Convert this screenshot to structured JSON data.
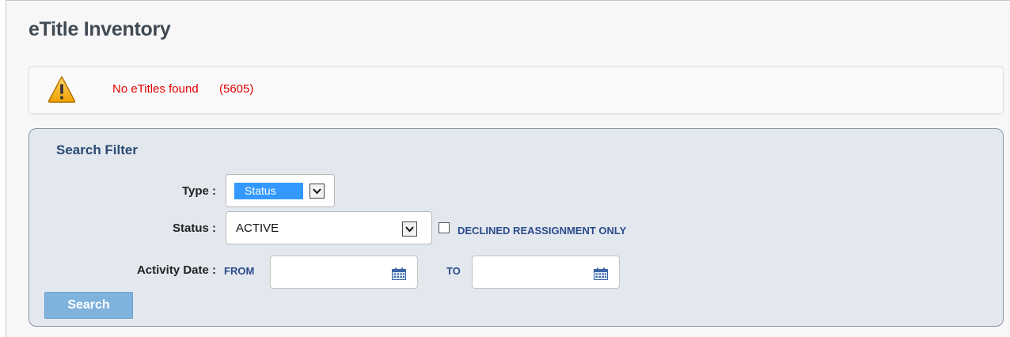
{
  "page": {
    "title": "eTitle Inventory"
  },
  "alert": {
    "message": "No eTitles found",
    "code": "(5605)",
    "icon": "warning-icon",
    "color": "#e00000"
  },
  "filter": {
    "title": "Search Filter",
    "type_label": "Type :",
    "type_value": "Status",
    "status_label": "Status :",
    "status_value": "ACTIVE",
    "declined_label": "DECLINED REASSIGNMENT ONLY",
    "declined_checked": false,
    "activity_label": "Activity Date :",
    "from_label": "FROM",
    "to_label": "TO",
    "from_value": "",
    "to_value": "",
    "search_label": "Search"
  },
  "colors": {
    "accent": "#3399ff",
    "panel_bg": "#e3e8ef",
    "title": "#2b4a72",
    "button": "#7fb2dd"
  }
}
